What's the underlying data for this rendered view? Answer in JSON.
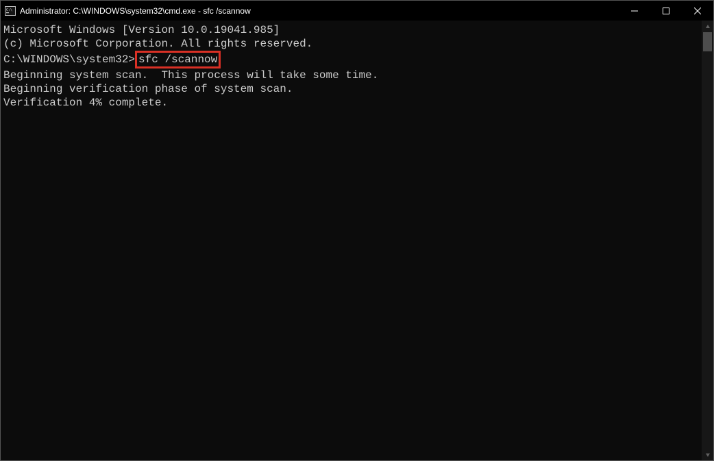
{
  "titlebar": {
    "title": "Administrator: C:\\WINDOWS\\system32\\cmd.exe - sfc  /scannow"
  },
  "terminal": {
    "line1": "Microsoft Windows [Version 10.0.19041.985]",
    "line2": "(c) Microsoft Corporation. All rights reserved.",
    "prompt": "C:\\WINDOWS\\system32>",
    "command": "sfc /scannow",
    "line5": "Beginning system scan.  This process will take some time.",
    "line7": "Beginning verification phase of system scan.",
    "line8": "Verification 4% complete."
  }
}
